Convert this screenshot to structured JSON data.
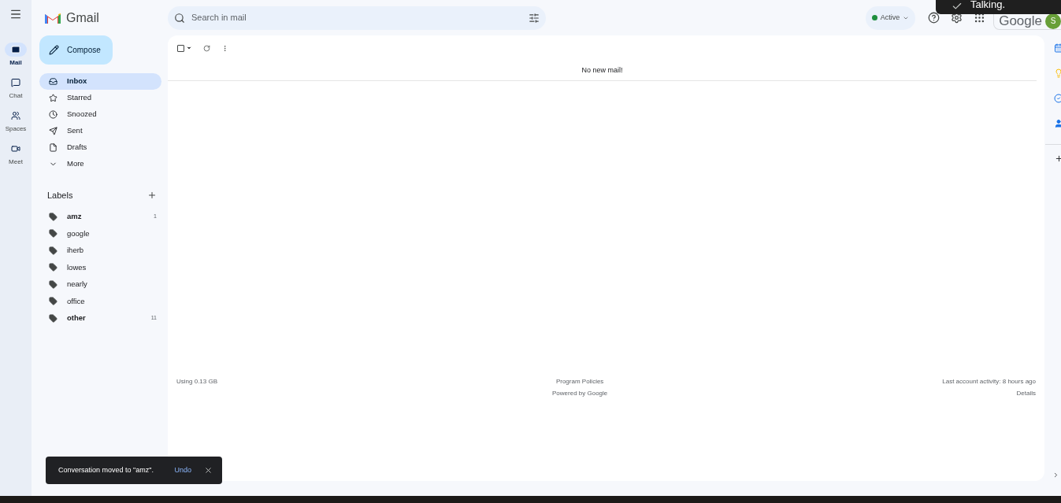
{
  "app": {
    "name": "Gmail"
  },
  "rail": [
    {
      "label": "Mail",
      "selected": true
    },
    {
      "label": "Chat",
      "selected": false
    },
    {
      "label": "Spaces",
      "selected": false
    },
    {
      "label": "Meet",
      "selected": false
    }
  ],
  "compose": "Compose",
  "search": {
    "placeholder": "Search in mail"
  },
  "status": {
    "label": "Active",
    "color": "#1e8e3e"
  },
  "account": {
    "brand": "Google",
    "initial": "S"
  },
  "select_all": {
    "checked": false
  },
  "notification": {
    "text": "Talking."
  },
  "folders": [
    {
      "label": "Inbox",
      "selected": true
    },
    {
      "label": "Starred",
      "selected": false
    },
    {
      "label": "Snoozed",
      "selected": false
    },
    {
      "label": "Sent",
      "selected": false
    },
    {
      "label": "Drafts",
      "selected": false
    },
    {
      "label": "More",
      "selected": false
    }
  ],
  "labels_heading": "Labels",
  "labels": [
    {
      "name": "amz",
      "count": "1",
      "unread": true
    },
    {
      "name": "google",
      "unread": false
    },
    {
      "name": "iherb",
      "unread": false
    },
    {
      "name": "lowes",
      "unread": false
    },
    {
      "name": "nearly",
      "unread": false
    },
    {
      "name": "office",
      "unread": false
    },
    {
      "name": "other",
      "count": "11",
      "unread": true
    }
  ],
  "empty_message": "No new mail!",
  "footer": {
    "storage": "Using 0.13 GB",
    "links": [
      "Program Policies",
      "Powered by Google"
    ],
    "activity": "Last account activity: 8 hours ago",
    "details": "Details"
  },
  "snackbar": {
    "text": "Conversation moved to \"amz\".",
    "action": "Undo"
  }
}
